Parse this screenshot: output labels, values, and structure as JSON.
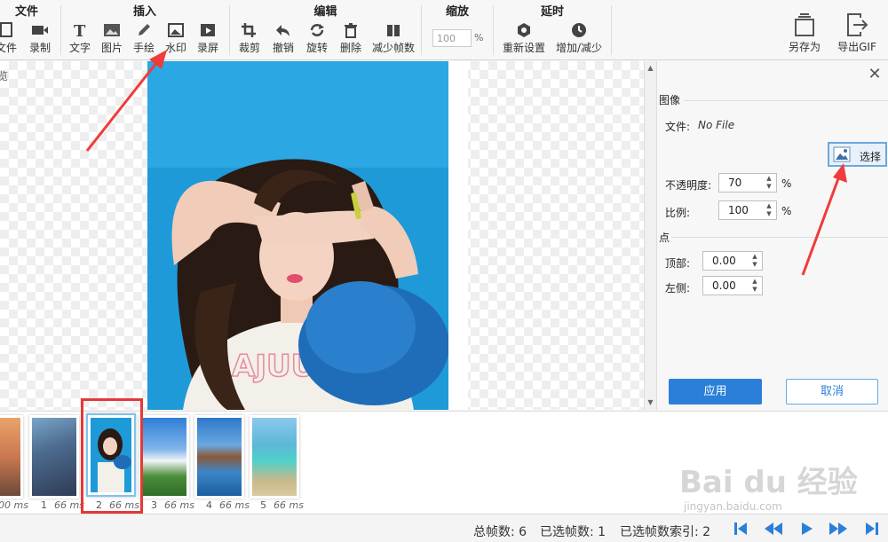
{
  "ribbon": {
    "groups": [
      {
        "title": "文件",
        "tools": [
          {
            "label": "文件",
            "icon": "open-file-icon"
          },
          {
            "label": "录制",
            "icon": "record-icon"
          }
        ]
      },
      {
        "title": "插入",
        "tools": [
          {
            "label": "文字",
            "icon": "text-icon"
          },
          {
            "label": "图片",
            "icon": "image-icon"
          },
          {
            "label": "手绘",
            "icon": "pencil-icon"
          },
          {
            "label": "水印",
            "icon": "watermark-icon"
          },
          {
            "label": "录屏",
            "icon": "screen-record-icon"
          }
        ]
      },
      {
        "title": "编辑",
        "tools": [
          {
            "label": "裁剪",
            "icon": "crop-icon"
          },
          {
            "label": "撤销",
            "icon": "undo-icon"
          },
          {
            "label": "旋转",
            "icon": "rotate-icon"
          },
          {
            "label": "删除",
            "icon": "trash-icon"
          },
          {
            "label": "减少帧数",
            "icon": "reduce-frames-icon"
          }
        ]
      },
      {
        "title": "缩放",
        "zoom_value": "100",
        "zoom_unit": "%"
      },
      {
        "title": "延时",
        "tools": [
          {
            "label": "重新设置",
            "icon": "reset-delay-icon"
          },
          {
            "label": "增加/减少",
            "icon": "clock-icon"
          }
        ]
      }
    ],
    "right_tools": [
      {
        "label": "另存为",
        "icon": "save-as-icon"
      },
      {
        "label": "导出GIF",
        "icon": "export-icon"
      }
    ]
  },
  "canvas": {
    "edge_text": "览"
  },
  "panel": {
    "section_image": "图像",
    "file_label": "文件:",
    "file_value": "No File",
    "select_label": "选择",
    "opacity_label": "不透明度:",
    "opacity_value": "70",
    "opacity_unit": "%",
    "scale_label": "比例:",
    "scale_value": "100",
    "scale_unit": "%",
    "section_point": "点",
    "top_label": "顶部:",
    "top_value": "0.00",
    "left_label": "左侧:",
    "left_value": "0.00",
    "apply_label": "应用",
    "cancel_label": "取消"
  },
  "frames": [
    {
      "number": "",
      "duration": "00 ms"
    },
    {
      "number": "1",
      "duration": "66 ms"
    },
    {
      "number": "2",
      "duration": "66 ms",
      "selected": true
    },
    {
      "number": "3",
      "duration": "66 ms"
    },
    {
      "number": "4",
      "duration": "66 ms"
    },
    {
      "number": "5",
      "duration": "66 ms"
    }
  ],
  "status": {
    "total_frames": "总帧数: 6",
    "selected_frames": "已选帧数: 1",
    "selected_index": "已选帧数索引: 2"
  },
  "watermark_text": "Bai du 经验",
  "watermark_url": "jingyan.baidu.com",
  "colors": {
    "accent": "#2b7fd8",
    "highlight": "#e53935",
    "photo_bg": "#1e9ad8"
  }
}
